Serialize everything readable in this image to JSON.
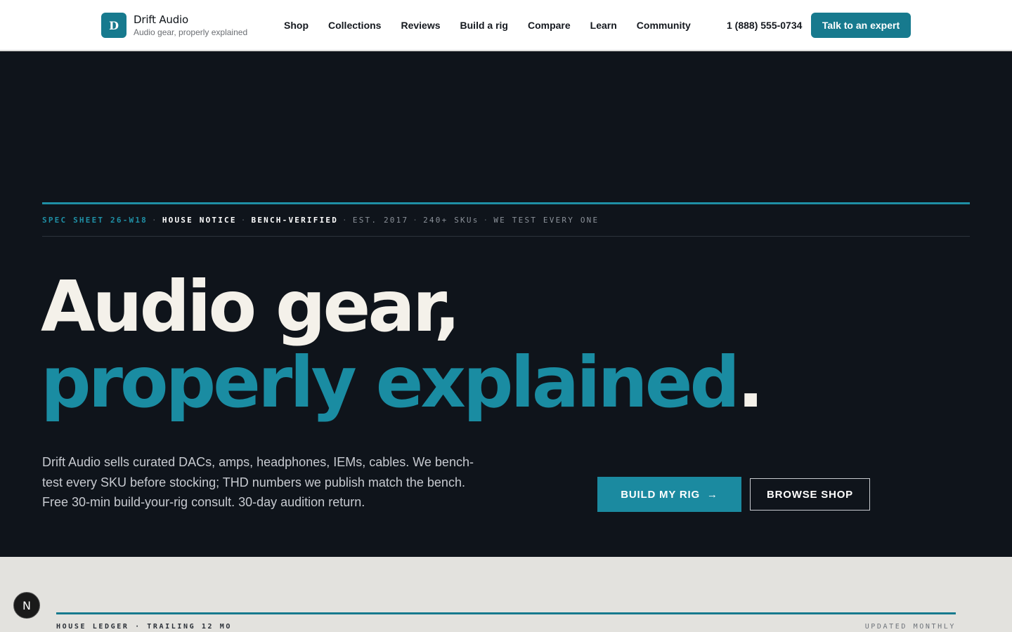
{
  "brand": {
    "logo_letter": "D",
    "name": "Drift Audio",
    "tagline": "Audio gear, properly explained"
  },
  "nav": {
    "items": [
      "Shop",
      "Collections",
      "Reviews",
      "Build a rig",
      "Compare",
      "Learn",
      "Community"
    ]
  },
  "header": {
    "phone": "1 (888) 555-0734",
    "cta_label": "Talk to an expert"
  },
  "notice": {
    "sheet": "SPEC SHEET 26-W18",
    "house": "HOUSE NOTICE",
    "verified": "BENCH-VERIFIED",
    "est": "EST. 2017",
    "skus": "240+ SKUs",
    "test": "WE TEST EVERY ONE",
    "separator": "·"
  },
  "hero": {
    "headline_line1": "Audio gear,",
    "headline_line2": "properly explained",
    "headline_period": ".",
    "lede": "Drift Audio sells curated DACs, amps, headphones, IEMs, cables. We bench-test every SKU before stocking; THD numbers we publish match the bench. Free 30-min build-your-rig consult. 30-day audition return.",
    "primary_label": "BUILD MY RIG",
    "primary_arrow": "→",
    "secondary_label": "BROWSE SHOP"
  },
  "ledger": {
    "left": "HOUSE LEDGER · TRAILING 12 MO",
    "right": "UPDATED MONTHLY"
  },
  "badge": {
    "letter": "N"
  },
  "colors": {
    "accent": "#177a8e",
    "hero_bg": "#0f141b",
    "headline_teal": "#1a8ca2",
    "page_bg": "#e3e2de"
  }
}
